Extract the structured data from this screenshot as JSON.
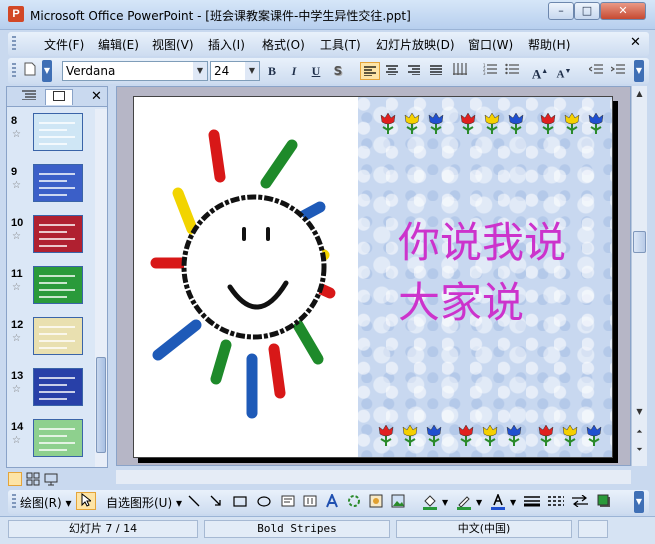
{
  "window": {
    "title": "Microsoft Office PowerPoint - [班会课教案课件-中学生异性交往.ppt]",
    "app_icon": "powerpoint-icon",
    "app_icon_letter": "P",
    "minimize": "–",
    "maximize": "□",
    "close": "✕"
  },
  "menu": {
    "items": [
      "文件(F)",
      "编辑(E)",
      "视图(V)",
      "插入(I)",
      "格式(O)",
      "工具(T)",
      "幻灯片放映(D)",
      "窗口(W)",
      "帮助(H)"
    ],
    "doc_close": "✕"
  },
  "toolbar": {
    "font_name": "Verdana",
    "font_size": "24",
    "bold": "B",
    "italic": "I",
    "underline": "U",
    "shadow": "S",
    "increase_font": "A",
    "decrease_font": "A"
  },
  "slides_pane": {
    "tabs": [
      "outline-icon",
      "slides-icon"
    ],
    "close": "✕",
    "items": [
      {
        "number": "8",
        "thumb_color": "#cfe6f5"
      },
      {
        "number": "9",
        "thumb_color": "#3b5fc8"
      },
      {
        "number": "10",
        "thumb_color": "#b02030"
      },
      {
        "number": "11",
        "thumb_color": "#2a9a3a"
      },
      {
        "number": "12",
        "thumb_color": "#e9e0b0"
      },
      {
        "number": "13",
        "thumb_color": "#2840a8"
      },
      {
        "number": "14",
        "thumb_color": "#8ed08e"
      }
    ]
  },
  "slide": {
    "line1": "你说我说",
    "line2": "大家说",
    "text_color": "#cc33cc",
    "background": "#c8d8f0"
  },
  "drawing_toolbar": {
    "draw_label": "绘图(R)",
    "autoshapes_label": "自选图形(U)"
  },
  "status": {
    "slide_info": "幻灯片 7 / 14",
    "design": "Bold Stripes",
    "language": "中文(中国)"
  },
  "colors": {
    "flower_red": "#e02020",
    "flower_yellow": "#f5d000",
    "flower_blue": "#2050d0",
    "flower_stem": "#2a8a2a"
  }
}
